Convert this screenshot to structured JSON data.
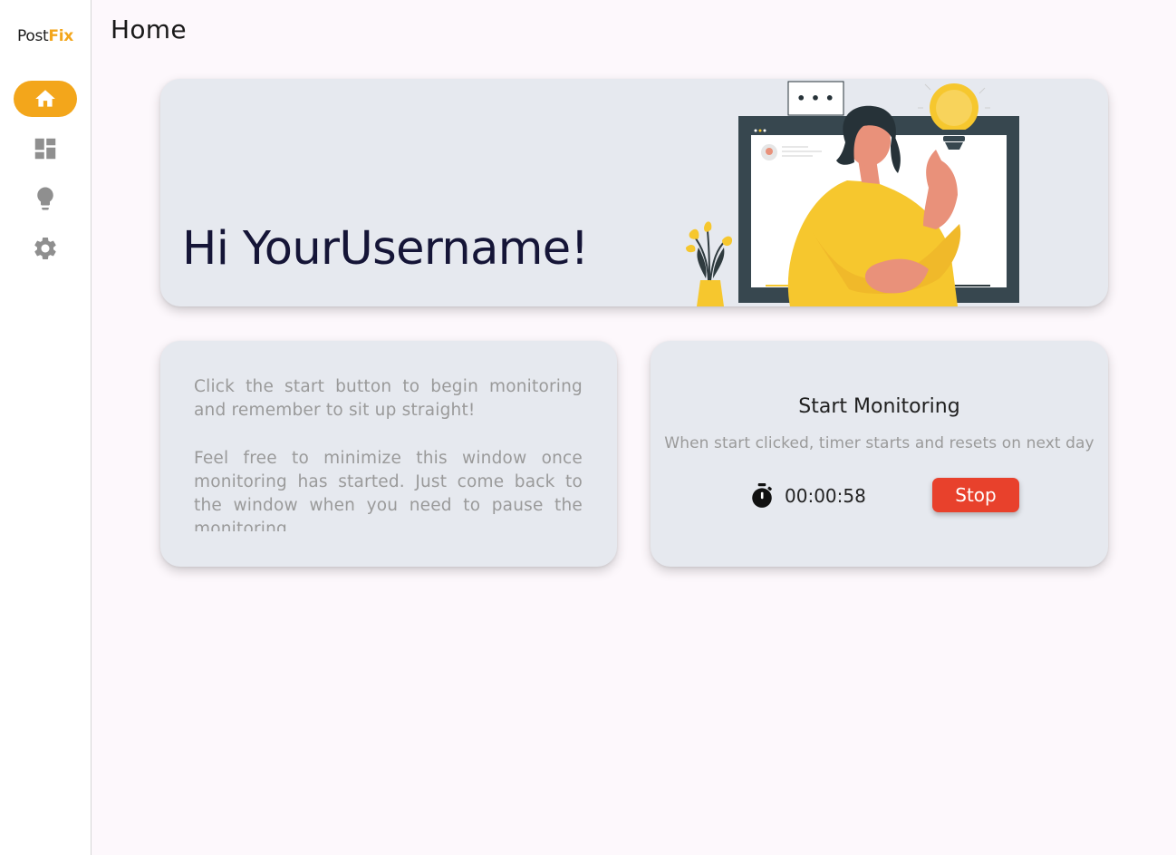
{
  "app": {
    "brand_prefix": "Post",
    "brand_accent": "Fix",
    "accent_color": "#f3a61b"
  },
  "sidebar": {
    "items": [
      {
        "icon": "home-icon",
        "active": true
      },
      {
        "icon": "dashboard-icon",
        "active": false
      },
      {
        "icon": "lightbulb-icon",
        "active": false
      },
      {
        "icon": "gear-icon",
        "active": false
      }
    ]
  },
  "header": {
    "title": "Home"
  },
  "hero": {
    "greeting": "Hi YourUsername!",
    "speech_bubble": "• • •"
  },
  "info": {
    "paragraph_1": "Click the start button to begin monitoring and remember to sit up straight!",
    "paragraph_2": "Feel free to minimize this window once monitoring has started. Just come back to the window when you need to pause the monitoring."
  },
  "monitor": {
    "title": "Start Monitoring",
    "subtitle": "When start clicked, timer starts and resets on next day",
    "timer": "00:00:58",
    "stop_label": "Stop",
    "stop_color": "#e8412c"
  }
}
